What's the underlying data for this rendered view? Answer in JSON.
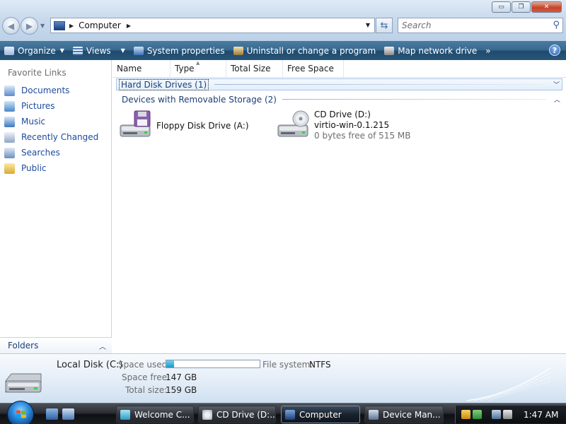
{
  "window": {
    "buttons": {
      "minimize": "▭",
      "maximize": "❐",
      "close": "✕"
    }
  },
  "navigation": {
    "back_icon": "back-arrow-icon",
    "forward_icon": "forward-arrow-icon"
  },
  "address_bar": {
    "location": "Computer"
  },
  "search": {
    "placeholder": "Search"
  },
  "command_bar": {
    "organize": "Organize",
    "views": "Views",
    "system_properties": "System properties",
    "uninstall": "Uninstall or change a program",
    "map_network_drive": "Map network drive",
    "overflow": "»",
    "help": "?"
  },
  "sidebar": {
    "header": "Favorite Links",
    "items": [
      {
        "label": "Documents",
        "icon": "documents-icon"
      },
      {
        "label": "Pictures",
        "icon": "pictures-icon"
      },
      {
        "label": "Music",
        "icon": "music-icon"
      },
      {
        "label": "Recently Changed",
        "icon": "recently-changed-icon"
      },
      {
        "label": "Searches",
        "icon": "searches-icon"
      },
      {
        "label": "Public",
        "icon": "public-folder-icon"
      }
    ],
    "folders_label": "Folders"
  },
  "columns": [
    "Name",
    "Type",
    "Total Size",
    "Free Space"
  ],
  "groups": {
    "hard_disk": {
      "label": "Hard Disk Drives (1)"
    },
    "removable": {
      "label": "Devices with Removable Storage (2)"
    }
  },
  "drives": {
    "floppy": {
      "name": "Floppy Disk Drive (A:)"
    },
    "cd": {
      "name": "CD Drive (D:)",
      "volume": "virtio-win-0.1.215",
      "free": "0 bytes free of 515 MB"
    }
  },
  "details": {
    "name": "Local Disk (C:)",
    "space_used_label": "Space used:",
    "space_used_fraction": 0.08,
    "file_system_label": "File system:",
    "file_system": "NTFS",
    "space_free_label": "Space free:",
    "space_free": "147 GB",
    "total_size_label": "Total size:",
    "total_size": "159 GB"
  },
  "taskbar": {
    "tasks": [
      "Welcome C...",
      "CD Drive (D:...",
      "Computer",
      "Device Man..."
    ],
    "active_task": "Computer",
    "clock": "1:47 AM"
  },
  "colors": {
    "link_blue": "#1c4a9d",
    "command_bar": "#275779",
    "space_bar_fill": "#1d98c9"
  }
}
